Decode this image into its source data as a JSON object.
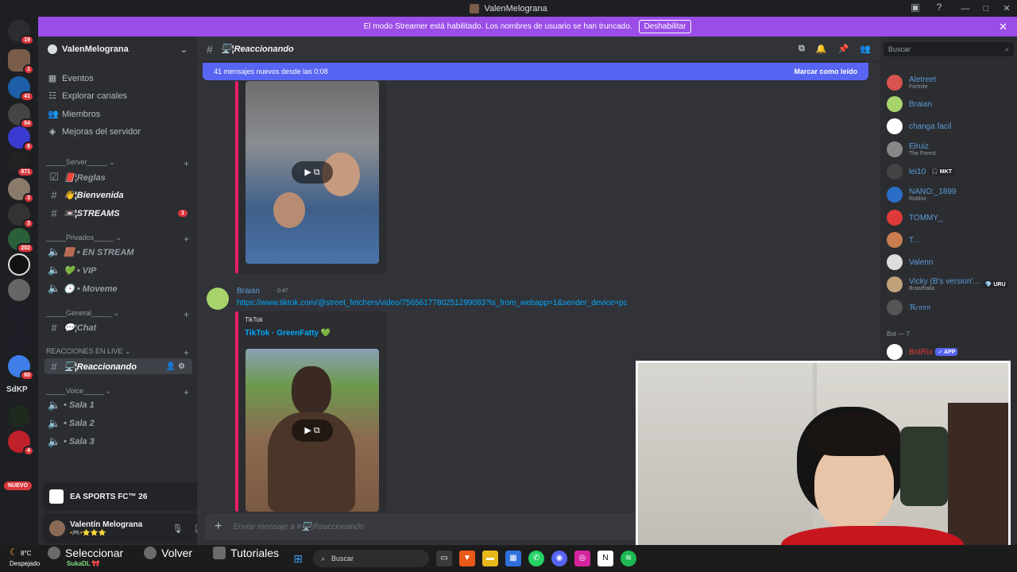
{
  "window": {
    "title": "ValenMelograna"
  },
  "banner": {
    "text": "El modo Streamer está habilitado. Los nombres de usuario se han truncado.",
    "button": "Deshabilitar"
  },
  "servers": [
    {
      "badge": "19"
    },
    {
      "badge": "1"
    },
    {
      "badge": "41"
    },
    {
      "badge": "54"
    },
    {
      "badge": "6"
    },
    {
      "badge": "871"
    },
    {
      "badge": "3"
    },
    {
      "badge": "3"
    },
    {
      "badge": "202"
    },
    {
      "badge": ""
    },
    {
      "badge": ""
    },
    {
      "badge": ""
    },
    {
      "badge": ""
    },
    {
      "badge": "60"
    },
    {
      "text": "SdKP"
    },
    {
      "badge": ""
    },
    {
      "badge": "4"
    }
  ],
  "nuevo_label": "NUEVO",
  "guild": {
    "name": "ValenMelograna",
    "nav": [
      "Eventos",
      "Explorar canales",
      "Miembros",
      "Mejoras del servidor"
    ],
    "categories": [
      {
        "name": "_____Server_____"
      },
      {
        "name": "_____Privados_____"
      },
      {
        "name": "_____General_____"
      },
      {
        "name": "REACCIONES EN LIVE"
      },
      {
        "name": "_____Voice_____"
      }
    ],
    "channels": {
      "reglas": "📕¦Reglas",
      "bienvenida": "👋¦Bienvenida",
      "streams": "📼¦STREAMS",
      "streams_unread": "1",
      "en_stream": "🟫 • EN STREAM",
      "vip": "💚 • VIP",
      "moveme": "🕒 • Moveme",
      "chat": "💬¦Chat",
      "reaccionando": "🖥️¦Reaccionando",
      "sala1": "• Sala 1",
      "sala2": "• Sala 2",
      "sala3": "• Sala 3"
    }
  },
  "game_activity": {
    "name": "EA SPORTS FC™ 26"
  },
  "user": {
    "name": "Valentín Melograna",
    "status": "•🎮•⭐⭐⭐"
  },
  "chat": {
    "channel_name": "🖥️¦Reaccionando",
    "new_messages": "41 mensajes nuevos desde las 0:08",
    "mark_read": "Marcar como leído",
    "message": {
      "author": "Braian",
      "time": "0:47",
      "link": "https://www.tiktok.com/@street_fetchers/video/7565617780251299083?is_from_webapp=1&sender_device=pc",
      "embed_provider": "TikTok",
      "embed_title": "TikTok · GreenFatty 💚"
    },
    "composer_placeholder": "Enviar mensaje a #🖥️¦Reaccionando"
  },
  "members": {
    "search_placeholder": "Buscar",
    "list": [
      {
        "name": "Aletreet",
        "activity": "Fortnite",
        "color": "#d9534f"
      },
      {
        "name": "Braian",
        "activity": "",
        "color": "#a7d36a"
      },
      {
        "name": "changa facil",
        "activity": "",
        "color": "#ffffff"
      },
      {
        "name": "Elruiz",
        "activity": "The Forest",
        "color": "#888888"
      },
      {
        "name": "lei10",
        "activity": "",
        "tag": "🎧 MKT",
        "color": "#444444"
      },
      {
        "name": "NANO:_1899",
        "activity": "Roblox",
        "color": "#2b6ec8"
      },
      {
        "name": "TOMMY_",
        "activity": "",
        "color": "#e03a3a"
      },
      {
        "name": "T...",
        "activity": "",
        "color": "#c97d4e"
      },
      {
        "name": "Valenn",
        "activity": "",
        "color": "#dddddd"
      },
      {
        "name": "Vicky (B's version'...",
        "activity": "Brawlhalla",
        "tag": "💎 URU",
        "color": "#c2a27a"
      },
      {
        "name": "ℜ𝔢𝔫𝔫𝔫",
        "activity": "",
        "color": "#555555"
      }
    ],
    "bot_section": "Bot — 7",
    "bot": {
      "name": "BotRix",
      "tag": "✓ APP",
      "color": "#ffffff"
    }
  },
  "taskbar": {
    "temp": "8°C",
    "weather": "Despejado",
    "overlay": [
      "Seleccionar",
      "Volver",
      "Tutoriales"
    ],
    "search": "Buscar",
    "user_tag": "SukaDL 🎀",
    "whatsapp_badge": "22"
  }
}
